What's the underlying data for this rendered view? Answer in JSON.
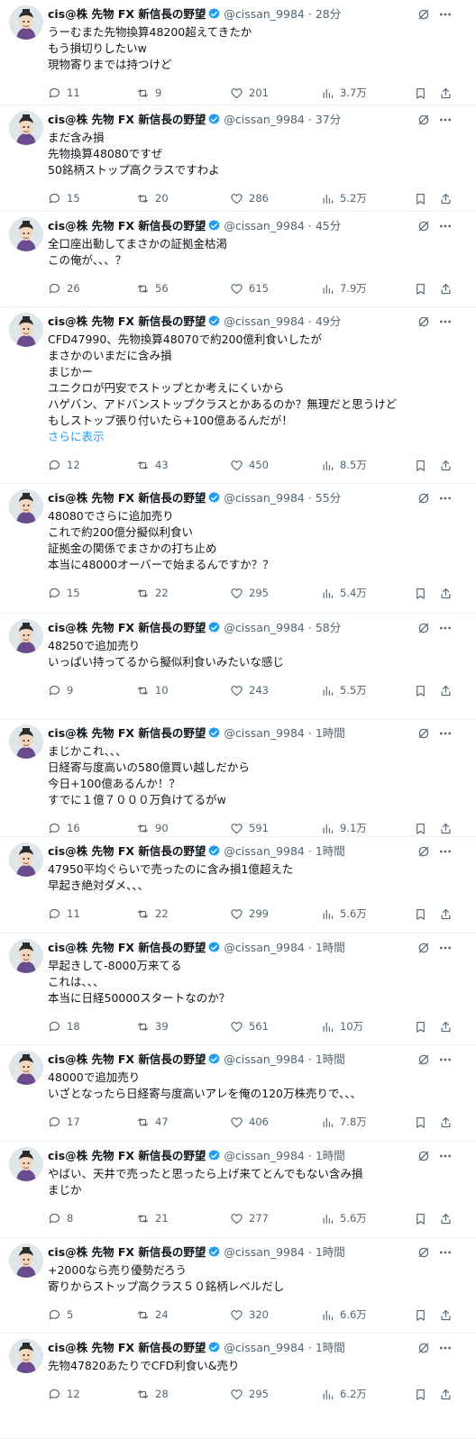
{
  "colors": {
    "text": "#0f1419",
    "muted": "#536471",
    "link": "#1d9bf0",
    "verified": "#1d9bf0",
    "divider": "#eff3f4"
  },
  "icons": {
    "reply": "reply-icon",
    "retweet": "retweet-icon",
    "like": "heart-icon",
    "views": "views-icon",
    "bookmark": "bookmark-icon",
    "share": "share-icon",
    "grok": "grok-icon",
    "more": "more-icon",
    "verified": "verified-badge-icon"
  },
  "tweets": [
    {
      "name": "cis@株 先物 FX 新信長の野望",
      "handle": "@cissan_9984",
      "time": "28分",
      "lines": [
        "うーむまた先物換算48200超えてきたか",
        "もう損切りしたいw",
        "現物寄りまでは持つけど"
      ],
      "replies": "11",
      "retweets": "9",
      "likes": "201",
      "views": "3.7万"
    },
    {
      "name": "cis@株 先物 FX 新信長の野望",
      "handle": "@cissan_9984",
      "time": "37分",
      "lines": [
        "まだ含み損",
        "先物換算48080ですぜ",
        "50銘柄ストップ高クラスですわよ"
      ],
      "replies": "15",
      "retweets": "20",
      "likes": "286",
      "views": "5.2万"
    },
    {
      "name": "cis@株 先物 FX 新信長の野望",
      "handle": "@cissan_9984",
      "time": "45分",
      "lines": [
        "全口座出動してまさかの証拠金枯渇",
        "この俺が、、、？"
      ],
      "replies": "26",
      "retweets": "56",
      "likes": "615",
      "views": "7.9万"
    },
    {
      "name": "cis@株 先物 FX 新信長の野望",
      "handle": "@cissan_9984",
      "time": "49分",
      "lines": [
        "CFD47990、先物換算48070で約200億利食いしたが",
        "まさかのいまだに含み損",
        "まじかー",
        "ユニクロが円安でストップとか考えにくいから",
        "ハゲバン、アドバンストップクラスとかあるのか？無理だと思うけど",
        "もしストップ張り付いたら+100億あるんだが！"
      ],
      "show_more": "さらに表示",
      "replies": "12",
      "retweets": "43",
      "likes": "450",
      "views": "8.5万"
    },
    {
      "name": "cis@株 先物 FX 新信長の野望",
      "handle": "@cissan_9984",
      "time": "55分",
      "lines": [
        "48080でさらに追加売り",
        "これで約200億分擬似利食い",
        "証拠金の関係でまさかの打ち止め",
        "本当に48000オーバーで始まるんですか？？"
      ],
      "replies": "15",
      "retweets": "22",
      "likes": "295",
      "views": "5.4万"
    },
    {
      "name": "cis@株 先物 FX 新信長の野望",
      "handle": "@cissan_9984",
      "time": "58分",
      "lines": [
        "48250で追加売り",
        "いっぱい持ってるから擬似利食いみたいな感じ"
      ],
      "replies": "9",
      "retweets": "10",
      "likes": "243",
      "views": "5.5万"
    },
    {
      "name": "cis@株 先物 FX 新信長の野望",
      "handle": "@cissan_9984",
      "time": "1時間",
      "lines": [
        "まじかこれ、、、",
        "日経寄与度高いの580億買い越しだから",
        "今日+100億あるんか！？",
        "すでに１億７０００万負けてるがw"
      ],
      "replies": "16",
      "retweets": "90",
      "likes": "591",
      "views": "9.1万"
    },
    {
      "name": "cis@株 先物 FX 新信長の野望",
      "handle": "@cissan_9984",
      "time": "1時間",
      "lines": [
        "47950平均ぐらいで売ったのに含み損1億超えた",
        "早起き絶対ダメ、、、"
      ],
      "replies": "11",
      "retweets": "22",
      "likes": "299",
      "views": "5.6万"
    },
    {
      "name": "cis@株 先物 FX 新信長の野望",
      "handle": "@cissan_9984",
      "time": "1時間",
      "lines": [
        "早起きして-8000万来てる",
        "これは、、、",
        "本当に日経50000スタートなのか？"
      ],
      "replies": "18",
      "retweets": "39",
      "likes": "561",
      "views": "10万"
    },
    {
      "name": "cis@株 先物 FX 新信長の野望",
      "handle": "@cissan_9984",
      "time": "1時間",
      "lines": [
        "48000で追加売り",
        "いざとなったら日経寄与度高いアレを俺の120万株売りで、、、"
      ],
      "replies": "17",
      "retweets": "47",
      "likes": "406",
      "views": "7.8万"
    },
    {
      "name": "cis@株 先物 FX 新信長の野望",
      "handle": "@cissan_9984",
      "time": "1時間",
      "lines": [
        "やばい、天井で売ったと思ったら上げ来てとんでもない含み損",
        "まじか"
      ],
      "replies": "8",
      "retweets": "21",
      "likes": "277",
      "views": "5.6万"
    },
    {
      "name": "cis@株 先物 FX 新信長の野望",
      "handle": "@cissan_9984",
      "time": "1時間",
      "lines": [
        "+2000なら売り優勢だろう",
        "寄りからストップ高クラス５０銘柄レベルだし"
      ],
      "replies": "5",
      "retweets": "24",
      "likes": "320",
      "views": "6.6万"
    },
    {
      "name": "cis@株 先物 FX 新信長の野望",
      "handle": "@cissan_9984",
      "time": "1時間",
      "lines": [
        "先物47820あたりでCFD利食い&売り"
      ],
      "replies": "12",
      "retweets": "28",
      "likes": "295",
      "views": "6.2万"
    }
  ]
}
